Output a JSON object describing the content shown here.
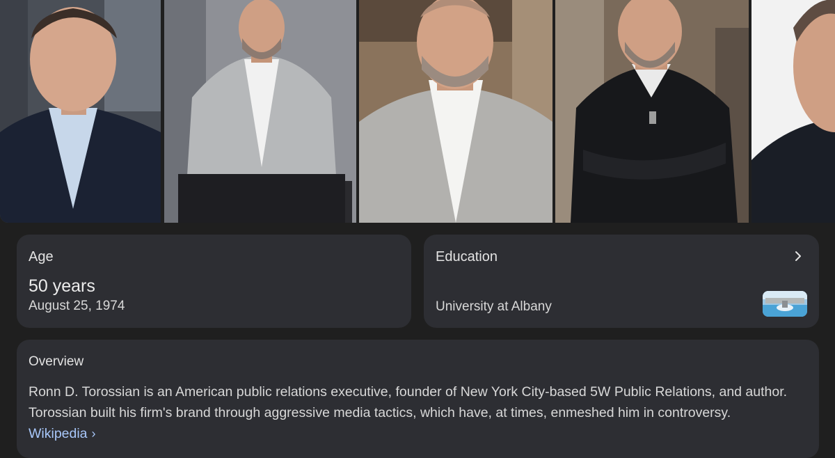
{
  "photos": [
    {
      "alt": "photo-1"
    },
    {
      "alt": "photo-2"
    },
    {
      "alt": "photo-3"
    },
    {
      "alt": "photo-4"
    },
    {
      "alt": "photo-5"
    }
  ],
  "age": {
    "label": "Age",
    "value": "50 years",
    "date": "August 25, 1974"
  },
  "education": {
    "label": "Education",
    "school": "University at Albany"
  },
  "overview": {
    "label": "Overview",
    "text": "Ronn D. Torossian is an American public relations executive, founder of New York City-based 5W Public Relations, and author. Torossian built his firm's brand through aggressive media tactics, which have, at times, enmeshed him in controversy.",
    "source_link": "Wikipedia",
    "source_chevron": "›"
  },
  "colors": {
    "background": "#1f1f1f",
    "card": "#2d2e33",
    "link": "#a8c7fa"
  },
  "icons": [
    "chevron-right-icon"
  ]
}
